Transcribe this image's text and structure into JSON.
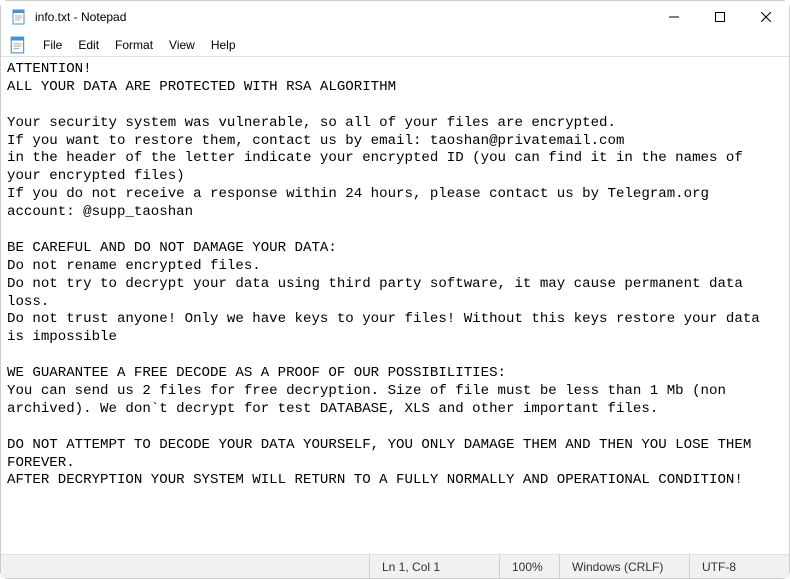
{
  "titlebar": {
    "title": "info.txt - Notepad"
  },
  "menubar": {
    "items": [
      "File",
      "Edit",
      "Format",
      "View",
      "Help"
    ]
  },
  "content": {
    "text": "ATTENTION!\nALL YOUR DATA ARE PROTECTED WITH RSA ALGORITHM\n\nYour security system was vulnerable, so all of your files are encrypted.\nIf you want to restore them, contact us by email: taoshan@privatemail.com\nin the header of the letter indicate your encrypted ID (you can find it in the names of your encrypted files)\nIf you do not receive a response within 24 hours, please contact us by Telegram.org account: @supp_taoshan\n\nBE CAREFUL AND DO NOT DAMAGE YOUR DATA:\nDo not rename encrypted files.\nDo not try to decrypt your data using third party software, it may cause permanent data loss.\nDo not trust anyone! Only we have keys to your files! Without this keys restore your data is impossible\n\nWE GUARANTEE A FREE DECODE AS A PROOF OF OUR POSSIBILITIES:\nYou can send us 2 files for free decryption. Size of file must be less than 1 Mb (non archived). We don`t decrypt for test DATABASE, XLS and other important files.\n\nDO NOT ATTEMPT TO DECODE YOUR DATA YOURSELF, YOU ONLY DAMAGE THEM AND THEN YOU LOSE THEM FOREVER.\nAFTER DECRYPTION YOUR SYSTEM WILL RETURN TO A FULLY NORMALLY AND OPERATIONAL CONDITION!"
  },
  "statusbar": {
    "position": "Ln 1, Col 1",
    "zoom": "100%",
    "lineEnding": "Windows (CRLF)",
    "encoding": "UTF-8"
  }
}
